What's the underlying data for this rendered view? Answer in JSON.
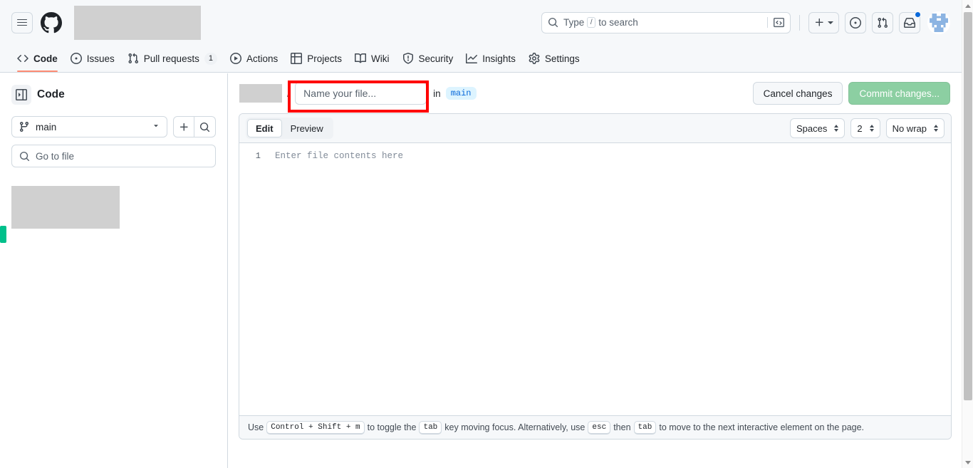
{
  "header": {
    "menu_icon": "hamburger-icon",
    "logo_icon": "github-mark-icon",
    "search": {
      "placeholder_prefix": "Type",
      "slash_key": "/",
      "placeholder_suffix": "to search",
      "search_icon": "search-icon",
      "terminal_icon": "command-palette-icon"
    },
    "create_new": {
      "icon": "plus-icon",
      "caret": "chevron-down-icon"
    },
    "issues_icon": "issue-opened-icon",
    "pull_requests_icon": "git-pull-request-icon",
    "inbox_icon": "inbox-icon",
    "has_unread_notification": true,
    "avatar_icon": "user-avatar"
  },
  "repo_nav": {
    "items": [
      {
        "label": "Code",
        "icon": "code-icon",
        "selected": true,
        "count": null
      },
      {
        "label": "Issues",
        "icon": "issue-opened-icon",
        "selected": false,
        "count": null
      },
      {
        "label": "Pull requests",
        "icon": "git-pull-request-icon",
        "selected": false,
        "count": "1"
      },
      {
        "label": "Actions",
        "icon": "play-icon",
        "selected": false,
        "count": null
      },
      {
        "label": "Projects",
        "icon": "table-icon",
        "selected": false,
        "count": null
      },
      {
        "label": "Wiki",
        "icon": "book-icon",
        "selected": false,
        "count": null
      },
      {
        "label": "Security",
        "icon": "shield-icon",
        "selected": false,
        "count": null
      },
      {
        "label": "Insights",
        "icon": "graph-icon",
        "selected": false,
        "count": null
      },
      {
        "label": "Settings",
        "icon": "gear-icon",
        "selected": false,
        "count": null
      }
    ]
  },
  "sidebar": {
    "title": "Code",
    "toggle_icon": "sidebar-collapse-icon",
    "branch": {
      "name": "main",
      "icon": "git-branch-icon",
      "caret": "chevron-down-icon"
    },
    "add_button_icon": "plus-icon",
    "search_button_icon": "search-icon",
    "file_search": {
      "placeholder": "Go to file",
      "icon": "search-icon"
    }
  },
  "file_header": {
    "separator": "/",
    "filename_value": "",
    "filename_placeholder": "Name your file...",
    "in_label": "in",
    "branch_chip": "main",
    "cancel_label": "Cancel changes",
    "commit_label": "Commit changes...",
    "commit_enabled": false,
    "highlight_color": "#ff0000"
  },
  "editor": {
    "tabs": [
      {
        "label": "Edit",
        "active": true
      },
      {
        "label": "Preview",
        "active": false
      }
    ],
    "settings": [
      {
        "name": "indent-mode",
        "value": "Spaces"
      },
      {
        "name": "indent-size",
        "value": "2"
      },
      {
        "name": "line-wrap",
        "value": "No wrap"
      }
    ],
    "line_number": "1",
    "content_placeholder": "Enter file contents here"
  },
  "hint_bar": {
    "part1": "Use",
    "key1": "Control + Shift + m",
    "part2": "to toggle the",
    "key2": "tab",
    "part3": "key moving focus. Alternatively, use",
    "key3": "esc",
    "part4": "then",
    "key4": "tab",
    "part5": "to move to the next interactive element on the page."
  },
  "scrollbar": {
    "up_arrow": "scroll-up-arrow",
    "down_arrow": "scroll-down-arrow",
    "marker_color": "#00c08b"
  },
  "colors": {
    "accent": "#0969da",
    "nav_underline": "#fd8c73",
    "commit_green": "#8ccfa2",
    "chip_bg": "#ddf4ff"
  }
}
